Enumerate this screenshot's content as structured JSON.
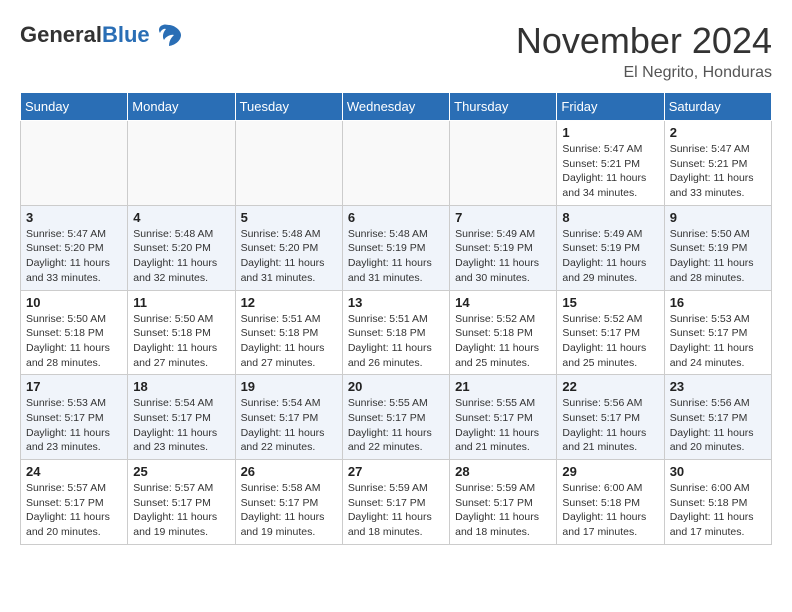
{
  "header": {
    "logo_general": "General",
    "logo_blue": "Blue",
    "month_title": "November 2024",
    "location": "El Negrito, Honduras"
  },
  "weekdays": [
    "Sunday",
    "Monday",
    "Tuesday",
    "Wednesday",
    "Thursday",
    "Friday",
    "Saturday"
  ],
  "weeks": [
    [
      {
        "day": "",
        "info": ""
      },
      {
        "day": "",
        "info": ""
      },
      {
        "day": "",
        "info": ""
      },
      {
        "day": "",
        "info": ""
      },
      {
        "day": "",
        "info": ""
      },
      {
        "day": "1",
        "info": "Sunrise: 5:47 AM\nSunset: 5:21 PM\nDaylight: 11 hours\nand 34 minutes."
      },
      {
        "day": "2",
        "info": "Sunrise: 5:47 AM\nSunset: 5:21 PM\nDaylight: 11 hours\nand 33 minutes."
      }
    ],
    [
      {
        "day": "3",
        "info": "Sunrise: 5:47 AM\nSunset: 5:20 PM\nDaylight: 11 hours\nand 33 minutes."
      },
      {
        "day": "4",
        "info": "Sunrise: 5:48 AM\nSunset: 5:20 PM\nDaylight: 11 hours\nand 32 minutes."
      },
      {
        "day": "5",
        "info": "Sunrise: 5:48 AM\nSunset: 5:20 PM\nDaylight: 11 hours\nand 31 minutes."
      },
      {
        "day": "6",
        "info": "Sunrise: 5:48 AM\nSunset: 5:19 PM\nDaylight: 11 hours\nand 31 minutes."
      },
      {
        "day": "7",
        "info": "Sunrise: 5:49 AM\nSunset: 5:19 PM\nDaylight: 11 hours\nand 30 minutes."
      },
      {
        "day": "8",
        "info": "Sunrise: 5:49 AM\nSunset: 5:19 PM\nDaylight: 11 hours\nand 29 minutes."
      },
      {
        "day": "9",
        "info": "Sunrise: 5:50 AM\nSunset: 5:19 PM\nDaylight: 11 hours\nand 28 minutes."
      }
    ],
    [
      {
        "day": "10",
        "info": "Sunrise: 5:50 AM\nSunset: 5:18 PM\nDaylight: 11 hours\nand 28 minutes."
      },
      {
        "day": "11",
        "info": "Sunrise: 5:50 AM\nSunset: 5:18 PM\nDaylight: 11 hours\nand 27 minutes."
      },
      {
        "day": "12",
        "info": "Sunrise: 5:51 AM\nSunset: 5:18 PM\nDaylight: 11 hours\nand 27 minutes."
      },
      {
        "day": "13",
        "info": "Sunrise: 5:51 AM\nSunset: 5:18 PM\nDaylight: 11 hours\nand 26 minutes."
      },
      {
        "day": "14",
        "info": "Sunrise: 5:52 AM\nSunset: 5:18 PM\nDaylight: 11 hours\nand 25 minutes."
      },
      {
        "day": "15",
        "info": "Sunrise: 5:52 AM\nSunset: 5:17 PM\nDaylight: 11 hours\nand 25 minutes."
      },
      {
        "day": "16",
        "info": "Sunrise: 5:53 AM\nSunset: 5:17 PM\nDaylight: 11 hours\nand 24 minutes."
      }
    ],
    [
      {
        "day": "17",
        "info": "Sunrise: 5:53 AM\nSunset: 5:17 PM\nDaylight: 11 hours\nand 23 minutes."
      },
      {
        "day": "18",
        "info": "Sunrise: 5:54 AM\nSunset: 5:17 PM\nDaylight: 11 hours\nand 23 minutes."
      },
      {
        "day": "19",
        "info": "Sunrise: 5:54 AM\nSunset: 5:17 PM\nDaylight: 11 hours\nand 22 minutes."
      },
      {
        "day": "20",
        "info": "Sunrise: 5:55 AM\nSunset: 5:17 PM\nDaylight: 11 hours\nand 22 minutes."
      },
      {
        "day": "21",
        "info": "Sunrise: 5:55 AM\nSunset: 5:17 PM\nDaylight: 11 hours\nand 21 minutes."
      },
      {
        "day": "22",
        "info": "Sunrise: 5:56 AM\nSunset: 5:17 PM\nDaylight: 11 hours\nand 21 minutes."
      },
      {
        "day": "23",
        "info": "Sunrise: 5:56 AM\nSunset: 5:17 PM\nDaylight: 11 hours\nand 20 minutes."
      }
    ],
    [
      {
        "day": "24",
        "info": "Sunrise: 5:57 AM\nSunset: 5:17 PM\nDaylight: 11 hours\nand 20 minutes."
      },
      {
        "day": "25",
        "info": "Sunrise: 5:57 AM\nSunset: 5:17 PM\nDaylight: 11 hours\nand 19 minutes."
      },
      {
        "day": "26",
        "info": "Sunrise: 5:58 AM\nSunset: 5:17 PM\nDaylight: 11 hours\nand 19 minutes."
      },
      {
        "day": "27",
        "info": "Sunrise: 5:59 AM\nSunset: 5:17 PM\nDaylight: 11 hours\nand 18 minutes."
      },
      {
        "day": "28",
        "info": "Sunrise: 5:59 AM\nSunset: 5:17 PM\nDaylight: 11 hours\nand 18 minutes."
      },
      {
        "day": "29",
        "info": "Sunrise: 6:00 AM\nSunset: 5:18 PM\nDaylight: 11 hours\nand 17 minutes."
      },
      {
        "day": "30",
        "info": "Sunrise: 6:00 AM\nSunset: 5:18 PM\nDaylight: 11 hours\nand 17 minutes."
      }
    ]
  ]
}
